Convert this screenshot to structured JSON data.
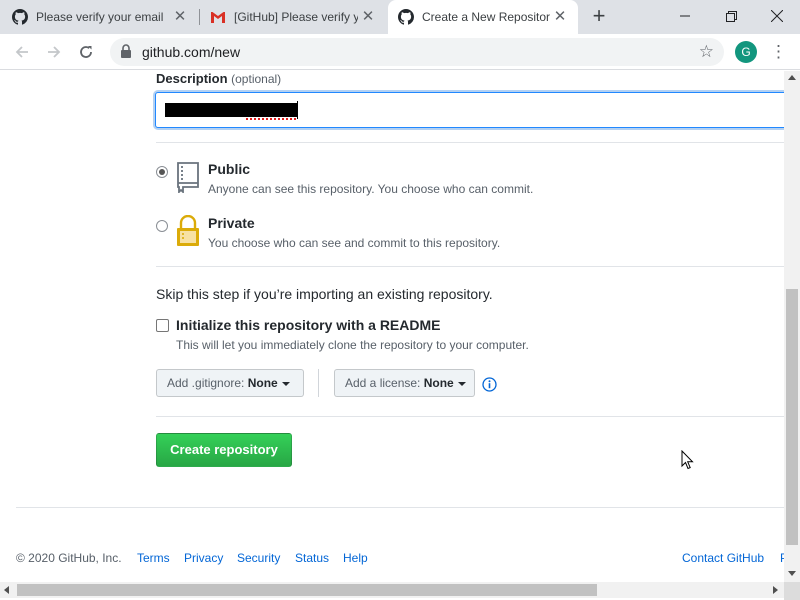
{
  "browser": {
    "tabs": [
      {
        "title": "Please verify your email",
        "icon": "github-icon"
      },
      {
        "title": "[GitHub] Please verify y",
        "icon": "gmail-icon"
      },
      {
        "title": "Create a New Repositor",
        "icon": "github-icon",
        "active": true
      }
    ],
    "new_tab_label": "+",
    "close_glyph": "✕",
    "url": "github.com/new",
    "avatar_letter": "G",
    "menu_glyph": "⋮",
    "star_glyph": "☆"
  },
  "form": {
    "description_label": "Description",
    "description_optional": "(optional)",
    "description_value": "[redacted]",
    "visibility": [
      {
        "title": "Public",
        "note": "Anyone can see this repository. You choose who can commit.",
        "icon": "repo-book-icon",
        "checked": true
      },
      {
        "title": "Private",
        "note": "You choose who can see and commit to this repository.",
        "icon": "lock-icon",
        "checked": false
      }
    ],
    "skip_text": "Skip this step if you’re importing an existing repository.",
    "readme_label": "Initialize this repository with a README",
    "readme_note": "This will let you immediately clone the repository to your computer.",
    "readme_checked": false,
    "gitignore_prefix": "Add .gitignore:",
    "gitignore_value": "None",
    "license_prefix": "Add a license:",
    "license_value": "None",
    "create_label": "Create repository"
  },
  "footer": {
    "copyright": "© 2020 GitHub, Inc.",
    "links": [
      "Terms",
      "Privacy",
      "Security",
      "Status",
      "Help"
    ],
    "contact": "Contact GitHub",
    "truncated": "P"
  },
  "colors": {
    "accent_green": "#28a745",
    "link_blue": "#0366d6",
    "avatar_bg": "#12967e"
  }
}
